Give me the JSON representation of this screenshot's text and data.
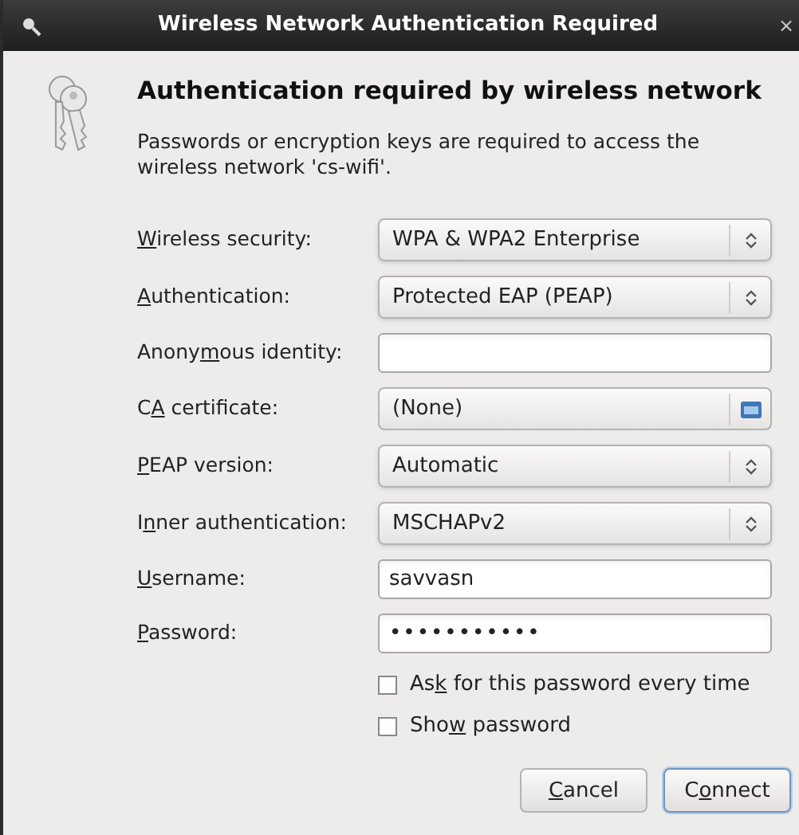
{
  "window": {
    "title": "Wireless Network Authentication Required",
    "close": "×"
  },
  "heading": "Authentication required by wireless network",
  "message": "Passwords or encryption keys are required to access the wireless network 'cs-wifi'.",
  "fields": [
    {
      "kind": "combo",
      "label": {
        "key": "W",
        "post": "ireless security:"
      },
      "value": "WPA & WPA2 Enterprise"
    },
    {
      "kind": "combo",
      "label": {
        "key": "A",
        "post": "uthentication:"
      },
      "value": "Protected EAP (PEAP)"
    },
    {
      "kind": "entry",
      "label": {
        "pre": "Anony",
        "key": "m",
        "post": "ous identity:"
      }
    },
    {
      "kind": "file",
      "label": {
        "pre": "C",
        "key": "A",
        "post": " certificate:"
      },
      "value": "(None)"
    },
    {
      "kind": "combo",
      "label": {
        "key": "P",
        "post": "EAP version:"
      },
      "value": "Automatic"
    },
    {
      "kind": "combo",
      "label": {
        "pre": "I",
        "key": "n",
        "post": "ner authentication:"
      },
      "value": "MSCHAPv2"
    },
    {
      "kind": "entry",
      "label": {
        "key": "U",
        "post": "sername:"
      },
      "value": "savvasn"
    },
    {
      "kind": "password",
      "label": {
        "key": "P",
        "post": "assword:"
      },
      "value": "•••••••••••"
    }
  ],
  "checkboxes": [
    {
      "label": {
        "pre": "As",
        "key": "k",
        "post": " for this password every time"
      },
      "checked": false
    },
    {
      "label": {
        "pre": "Sho",
        "key": "w",
        "post": " password"
      },
      "checked": false
    }
  ],
  "buttons": [
    {
      "label": {
        "key": "C",
        "post": "ancel"
      },
      "default": false
    },
    {
      "label": {
        "pre": "C",
        "key": "o",
        "post": "nnect"
      },
      "default": true
    }
  ]
}
